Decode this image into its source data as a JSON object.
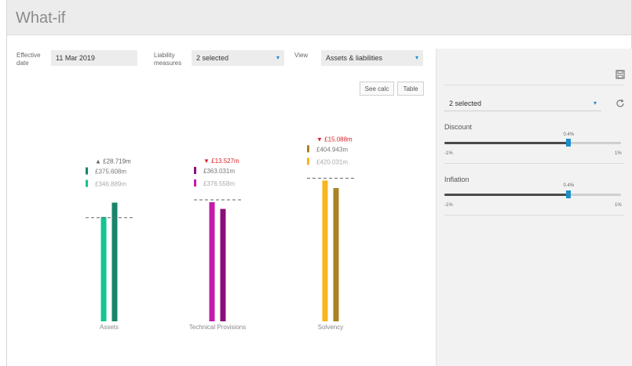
{
  "app": {
    "title": "What-if"
  },
  "controls": {
    "effective_date_label_1": "Effective",
    "effective_date_label_2": "date",
    "effective_date_value": "11 Mar 2019",
    "liability_label_1": "Liability",
    "liability_label_2": "measures",
    "liability_value": "2 selected",
    "view_label": "View",
    "view_value": "Assets & liabilities",
    "see_calc": "See calc",
    "table": "Table"
  },
  "side": {
    "select_value": "2 selected",
    "discount": {
      "label": "Discount",
      "value": 0.4,
      "value_text": "0.4%",
      "min": "-1%",
      "max": "1%"
    },
    "inflation": {
      "label": "Inflation",
      "value": 0.4,
      "value_text": "0.4%",
      "min": "-1%",
      "max": "1%"
    }
  },
  "chart_data": {
    "type": "bar",
    "categories": [
      "Assets",
      "Technical Provisions",
      "Solvency"
    ],
    "groups": [
      {
        "category": "Assets",
        "change": "▲ £28.719m",
        "change_dir": "up",
        "current": "£375.608m",
        "baseline": "£346.889m",
        "current_value": 375.608,
        "baseline_value": 346.889,
        "color_current": "#17856a",
        "color_baseline": "#16c48f"
      },
      {
        "category": "Technical Provisions",
        "change": "▼ £13.527m",
        "change_dir": "down",
        "current": "£363.031m",
        "baseline": "£376.558m",
        "current_value": 363.031,
        "baseline_value": 376.558,
        "color_current": "#8a0f78",
        "color_baseline": "#c41aac"
      },
      {
        "category": "Solvency",
        "change": "▼ £15.088m",
        "change_dir": "down",
        "current": "£404.943m",
        "baseline": "£420.031m",
        "current_value": 404.943,
        "baseline_value": 420.031,
        "color_current": "#a88224",
        "color_baseline": "#f7b51e"
      }
    ],
    "colors": {
      "up": "#666666",
      "down": "#d9262c"
    }
  }
}
